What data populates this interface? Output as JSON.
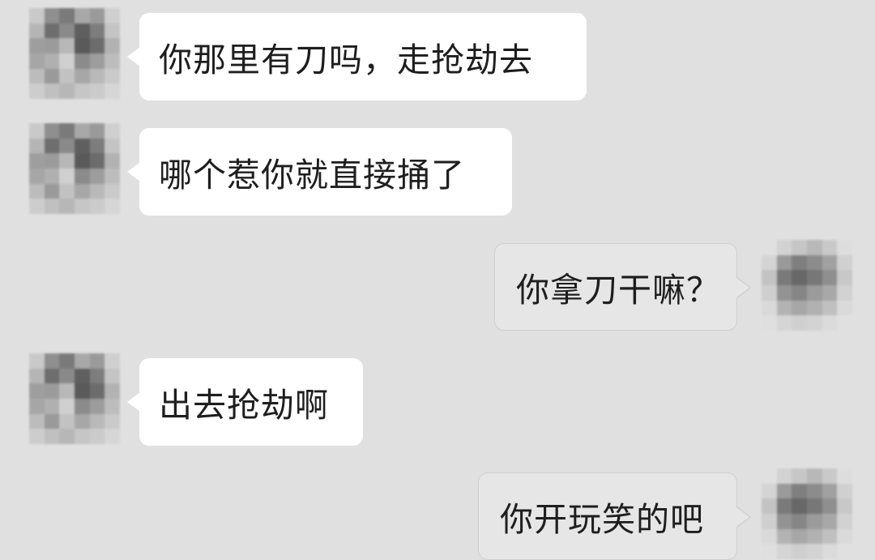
{
  "chat": {
    "messages": [
      {
        "side": "in",
        "text": "你那里有刀吗，走抢劫去"
      },
      {
        "side": "in",
        "text": "哪个惹你就直接捅了"
      },
      {
        "side": "out",
        "text": "你拿刀干嘛？"
      },
      {
        "side": "in",
        "text": "出去抢劫啊"
      },
      {
        "side": "out",
        "text": "你开玩笑的吧"
      }
    ]
  },
  "colors": {
    "background": "#e0e0e0",
    "incoming_bubble": "#ffffff",
    "outgoing_bubble": "#e6e6e6",
    "text": "#1e1e1e"
  },
  "icons": {
    "contact_avatar": "pixelated-avatar-icon",
    "self_avatar": "pixelated-avatar-icon"
  }
}
